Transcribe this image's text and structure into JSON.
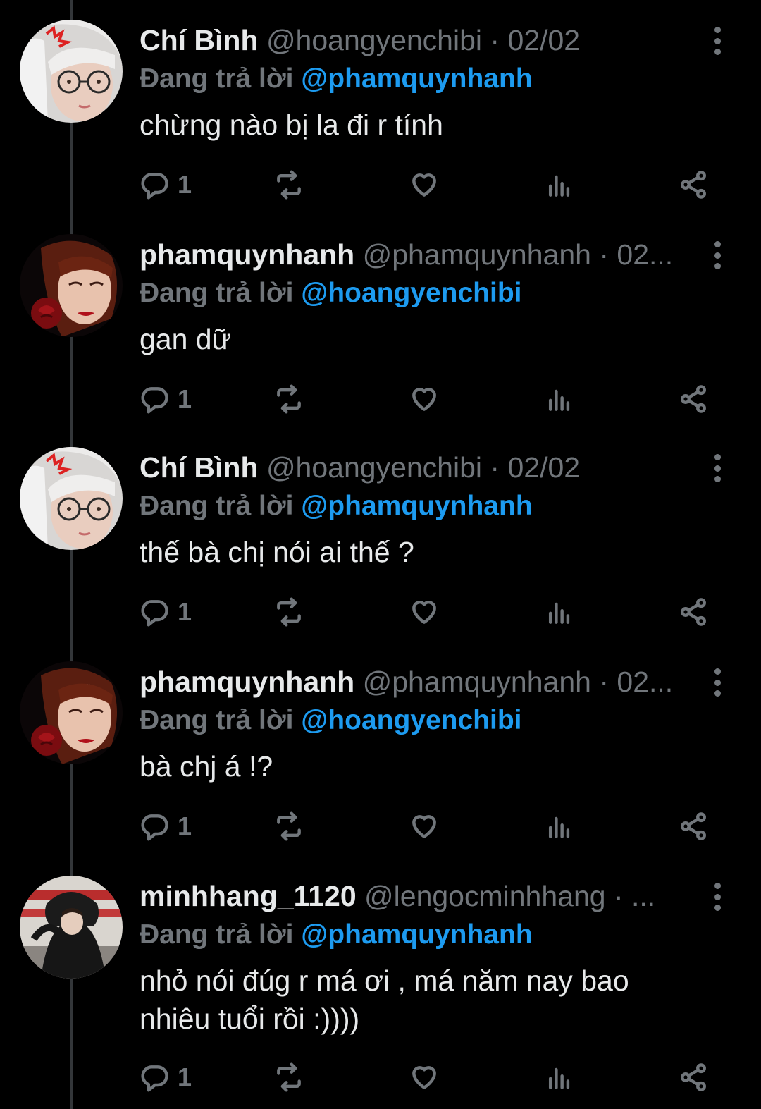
{
  "tweets": [
    {
      "name": "Chí Bình",
      "handle": "@hoangyenchibi",
      "separator": "·",
      "date": "02/02",
      "replying_label": "Đang trả lời",
      "replying_to": "@phamquynhanh",
      "text": "chừng nào bị la đi r tính",
      "reply_count": "1",
      "avatar": "avatar-glasses-girl"
    },
    {
      "name": "phamquynhanh",
      "handle": "@phamquynhanh",
      "separator": "·",
      "date": "02...",
      "replying_label": "Đang trả lời",
      "replying_to": "@hoangyenchibi",
      "text": "gan dữ",
      "reply_count": "1",
      "avatar": "avatar-rose-girl"
    },
    {
      "name": "Chí Bình",
      "handle": "@hoangyenchibi",
      "separator": "·",
      "date": "02/02",
      "replying_label": "Đang trả lời",
      "replying_to": "@phamquynhanh",
      "text": "thế bà chị nói ai thế ?",
      "reply_count": "1",
      "avatar": "avatar-glasses-girl"
    },
    {
      "name": "phamquynhanh",
      "handle": "@phamquynhanh",
      "separator": "·",
      "date": "02...",
      "replying_label": "Đang trả lời",
      "replying_to": "@hoangyenchibi",
      "text": "bà chj á !?",
      "reply_count": "1",
      "avatar": "avatar-rose-girl"
    },
    {
      "name": "minhhang_1120",
      "handle": "@lengocminhhang",
      "separator": "·",
      "date": "...",
      "replying_label": "Đang trả lời",
      "replying_to": "@phamquynhanh",
      "text": "nhỏ nói đúg r má ơi , má năm nay bao nhiêu tuổi rồi :))))",
      "reply_count": "1",
      "avatar": "avatar-hooded-girl"
    }
  ],
  "icons": {
    "reply": "reply-icon",
    "retweet": "retweet-icon",
    "like": "heart-icon",
    "views": "views-icon",
    "share": "share-icon",
    "more": "more-icon"
  },
  "colors": {
    "background": "#000000",
    "text": "#e7e9ea",
    "muted": "#71767b",
    "accent": "#1d9bf0",
    "thread_line": "#333639"
  }
}
